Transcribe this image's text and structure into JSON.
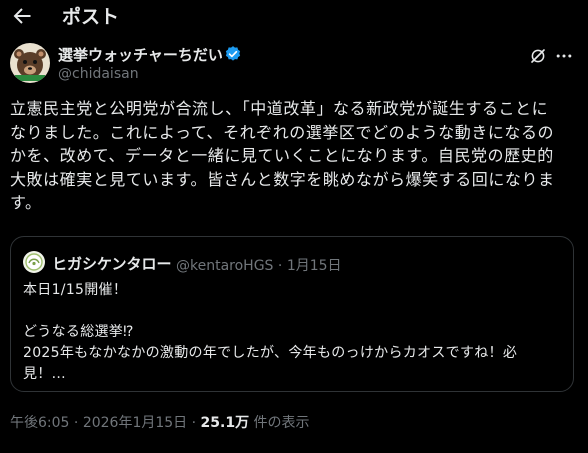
{
  "header": {
    "title": "ポスト"
  },
  "author": {
    "name": "選挙ウォッチャーちだい",
    "handle": "@chidaisan"
  },
  "post": {
    "text": "立憲民主党と公明党が合流し、「中道改革」なる新政党が誕生することに\nなりました。これによって、それぞれの選挙区でどのような動きになるの\nかを、改めて、データと一緒に見ていくことになります。自民党の歴史的\n大敗は確実と見ています。皆さんと数字を眺めながら爆笑する回になりま\nす。"
  },
  "quote": {
    "name": "ヒガシケンタロー",
    "handle": "@kentaroHGS",
    "separator": "·",
    "date": "1月15日",
    "text": "本日1/15開催！\n\nどうなる総選挙⁉\n2025年もなかなかの激動の年でしたが、今年ものっけからカオスですね！必\n見！..."
  },
  "footer": {
    "time": "午後6:05",
    "separator1": " · ",
    "date": "2026年1月15日",
    "separator2": " · ",
    "views_count": "25.1万",
    "views_label": " 件の表示"
  },
  "icons": {
    "back": "back-arrow-icon",
    "verified": "verified-badge-icon",
    "grok": "grok-icon",
    "more": "more-icon"
  },
  "colors": {
    "background": "#000000",
    "text": "#e7e9ea",
    "secondary": "#71767b",
    "border": "#2f3336",
    "verified": "#1d9bf0"
  }
}
